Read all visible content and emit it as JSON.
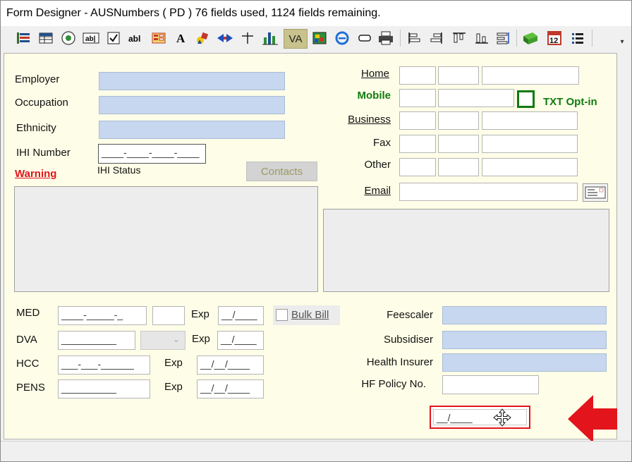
{
  "window": {
    "title": "Form Designer - AUSNumbers ( PD ) 76 fields used, 1124 fields remaining."
  },
  "toolbar": {
    "items": [
      "tree-view-icon",
      "table-icon",
      "radio-button-icon",
      "textbox-icon",
      "checkbox-icon",
      "label-text-icon",
      "form-fields-icon",
      "font-icon",
      "shapes-icon",
      "arrows-icon",
      "crosshair-icon",
      "bar-chart-icon",
      "VA",
      "color-map-icon",
      "internet-explorer-icon",
      "button-shape-icon",
      "printer-icon",
      "align-left-icon",
      "align-right-icon",
      "align-top-icon",
      "align-bottom-icon",
      "distribute-icon",
      "book-icon",
      "calendar-12-icon",
      "list-icon"
    ],
    "va_label": "VA",
    "active_item": "VA"
  },
  "form": {
    "left": {
      "employer_label": "Employer",
      "occupation_label": "Occupation",
      "ethnicity_label": "Ethnicity",
      "ihi_number_label": "IHI Number",
      "ihi_number_mask": "____-____-____-____",
      "warning_label": "Warning",
      "ihi_status_label": "IHI Status",
      "contacts_button": "Contacts"
    },
    "right": {
      "home_label": "Home",
      "mobile_label": "Mobile",
      "txt_optin_label": "TXT Opt-in",
      "business_label": "Business",
      "fax_label": "Fax",
      "other_label": "Other",
      "email_label": "Email"
    },
    "bottom": {
      "med_label": "MED",
      "med_mask": "____-_____-_",
      "exp_label": "Exp",
      "med_exp_mask": "__/____",
      "bulk_bill_label": "Bulk Bill",
      "dva_label": "DVA",
      "dva_mask": "__________",
      "dva_exp_mask": "__/____",
      "hcc_label": "HCC",
      "hcc_mask": "___-___-______",
      "hcc_exp_mask": "__/__/____",
      "pens_label": "PENS",
      "pens_mask": "__________",
      "pens_exp_mask": "__/__/____",
      "feescaler_label": "Feescaler",
      "subsidiser_label": "Subsidiser",
      "health_insurer_label": "Health Insurer",
      "hf_policy_label": "HF Policy No.",
      "selected_field_mask": "__/____"
    }
  },
  "colors": {
    "warning": "#e0141a",
    "mobile": "#0f7a0f",
    "canvas_bg": "#fefee8",
    "field_blue": "#c7d7ef",
    "arrow_red": "#e3141c"
  }
}
